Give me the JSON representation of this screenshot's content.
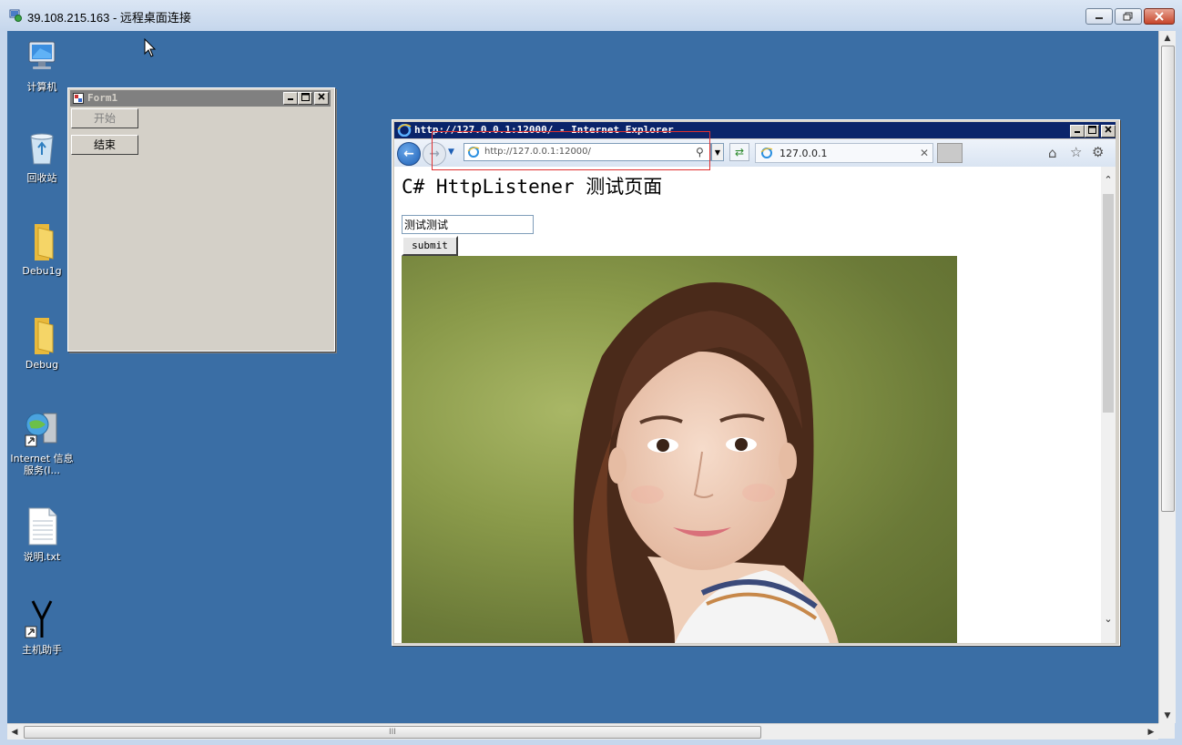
{
  "rdp": {
    "title": "39.108.215.163 - 远程桌面连接",
    "scrollbar_grip": "III"
  },
  "desktop": {
    "icons": [
      {
        "label": "计算机"
      },
      {
        "label": "回收站"
      },
      {
        "label": "Debu1g"
      },
      {
        "label": "Debug"
      },
      {
        "label": "Internet 信息服务(I..."
      },
      {
        "label": "说明.txt"
      },
      {
        "label": "主机助手"
      }
    ]
  },
  "form1": {
    "title": "Form1",
    "start_label": "开始",
    "end_label": "结束"
  },
  "ie": {
    "title": "http://127.0.0.1:12000/ - Internet Explorer",
    "address": "http://127.0.0.1:12000/",
    "tab_label": "127.0.0.1"
  },
  "page": {
    "heading": "C# HttpListener 测试页面",
    "input_value": "测试测试",
    "submit_label": "submit"
  },
  "colors": {
    "desktop_bg": "#3a6ea5",
    "ie_title_bg": "#0a246a",
    "highlight": "#e03030"
  }
}
